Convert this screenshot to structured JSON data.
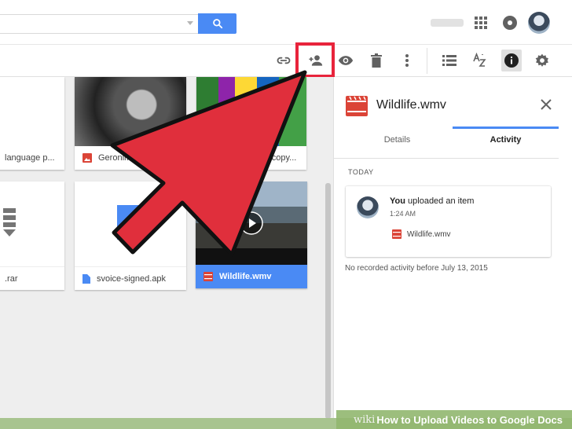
{
  "topbar": {
    "search": {
      "placeholder": ""
    },
    "icons": [
      "search-icon",
      "apps-grid-icon",
      "notifications-icon",
      "account-avatar"
    ]
  },
  "toolbar": {
    "icons": [
      "link-icon",
      "share-person-add-icon",
      "preview-eye-icon",
      "trash-icon",
      "more-vert-icon",
      "list-view-icon",
      "sort-az-icon",
      "info-icon",
      "settings-gear-icon"
    ]
  },
  "grid": {
    "tiles": [
      {
        "name": "language p..."
      },
      {
        "name": "Geronimo Ro..."
      },
      {
        "name": "...y copy..."
      },
      {
        "name": ".rar"
      },
      {
        "name": "svoice-signed.apk"
      },
      {
        "name": "Wildlife.wmv"
      }
    ]
  },
  "panel": {
    "title": "Wildlife.wmv",
    "tabs": [
      {
        "label": "Details"
      },
      {
        "label": "Activity"
      }
    ],
    "active_tab": "Activity",
    "section_label": "TODAY",
    "activity": {
      "actor": "You",
      "action": " uploaded an item",
      "time": "1:24 AM",
      "file": "Wildlife.wmv"
    },
    "no_activity": "No recorded activity before July 13, 2015"
  },
  "footer": {
    "logo": "wiki",
    "caption": "How to Upload Videos to Google Docs"
  },
  "colors": {
    "accent_blue": "#4a8af4",
    "highlight_red": "#e8243b",
    "video_red": "#db4437",
    "footer_green": "#91b76f"
  }
}
